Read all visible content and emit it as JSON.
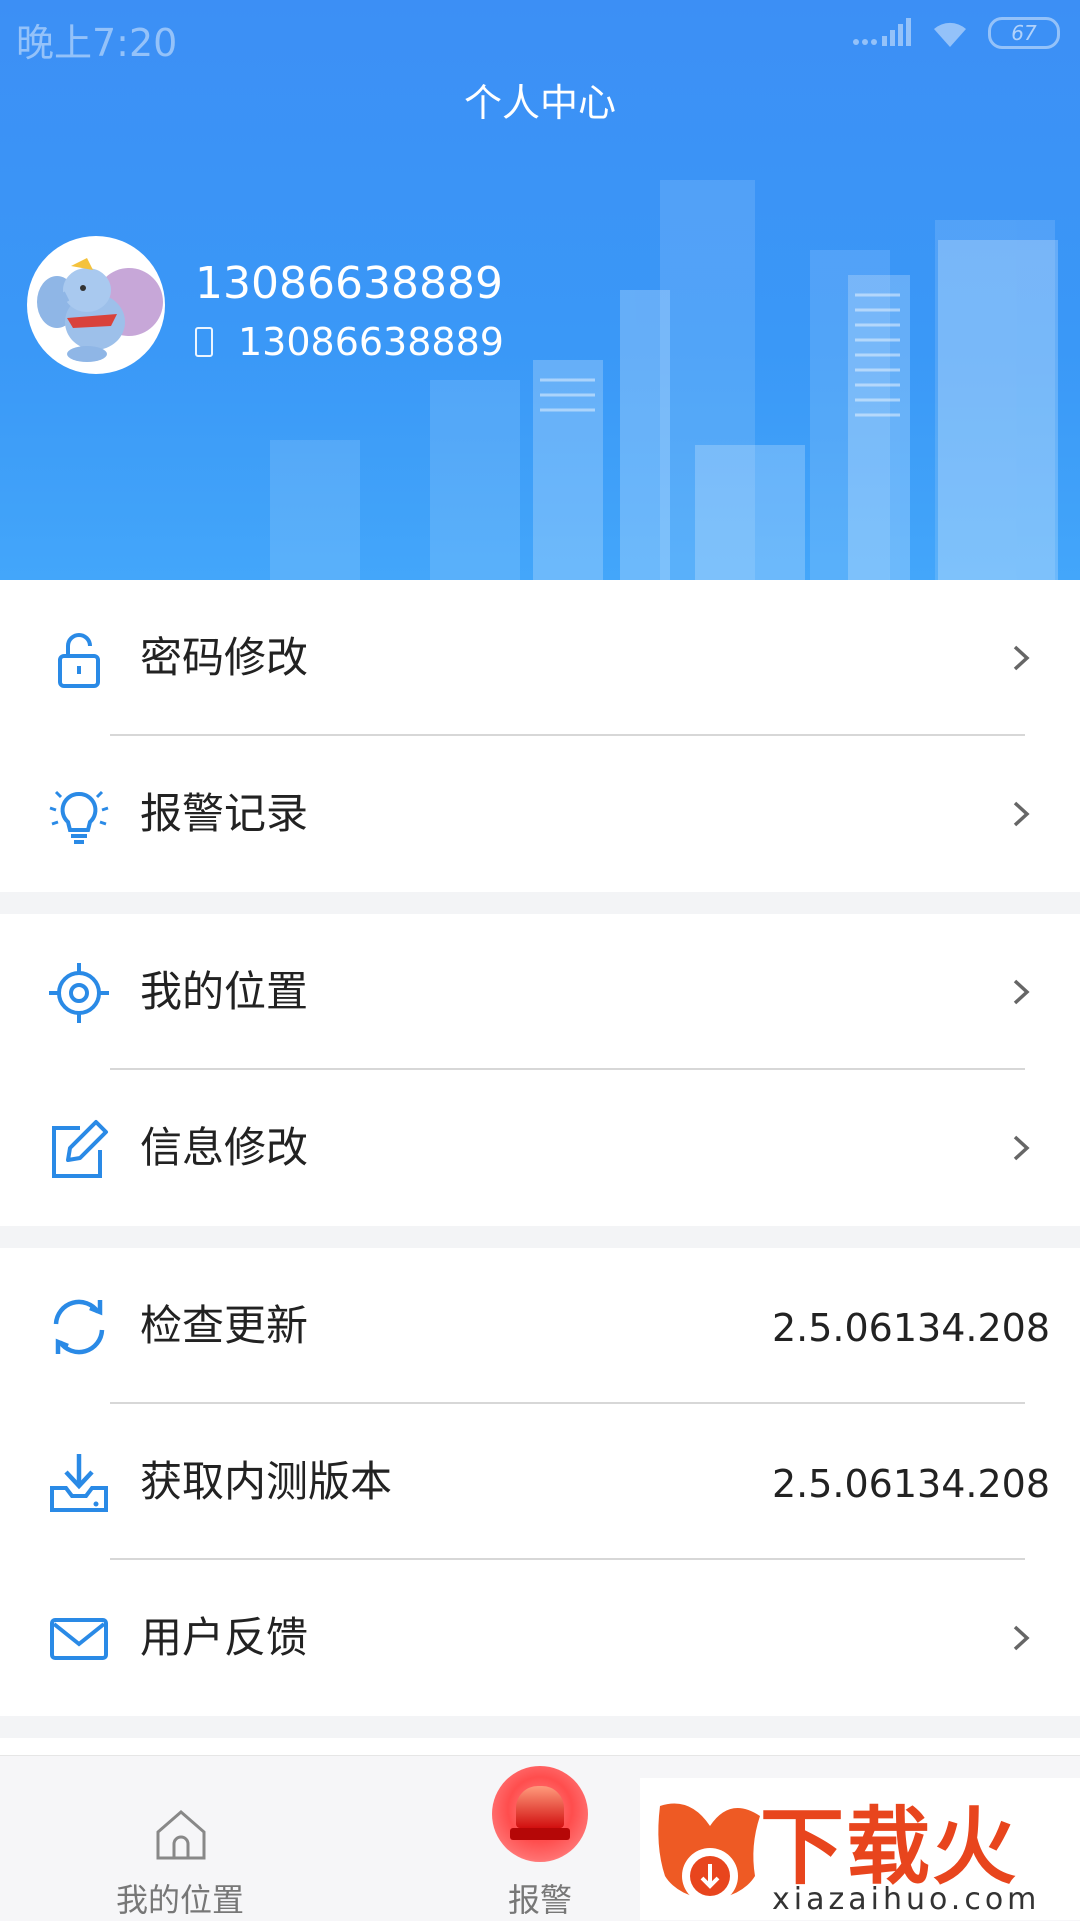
{
  "status_bar": {
    "time": "晚上7:20",
    "battery": "67"
  },
  "header": {
    "title": "个人中心",
    "user_name": "13086638889",
    "phone": "13086638889"
  },
  "menu": {
    "password": "密码修改",
    "alarm_records": "报警记录",
    "my_location": "我的位置",
    "edit_info": "信息修改",
    "check_update": {
      "label": "检查更新",
      "value": "2.5.06134.208"
    },
    "beta": {
      "label": "获取内测版本",
      "value": "2.5.06134.208"
    },
    "feedback": "用户反馈"
  },
  "tabbar": {
    "home": "我的位置",
    "alarm": "报警"
  },
  "watermark": {
    "title": "下载火",
    "site": "xiazaihuo.com"
  },
  "colors": {
    "header_blue": "#3c8ff5",
    "icon_blue": "#2a8ae6",
    "alarm_red": "#e8451d"
  }
}
